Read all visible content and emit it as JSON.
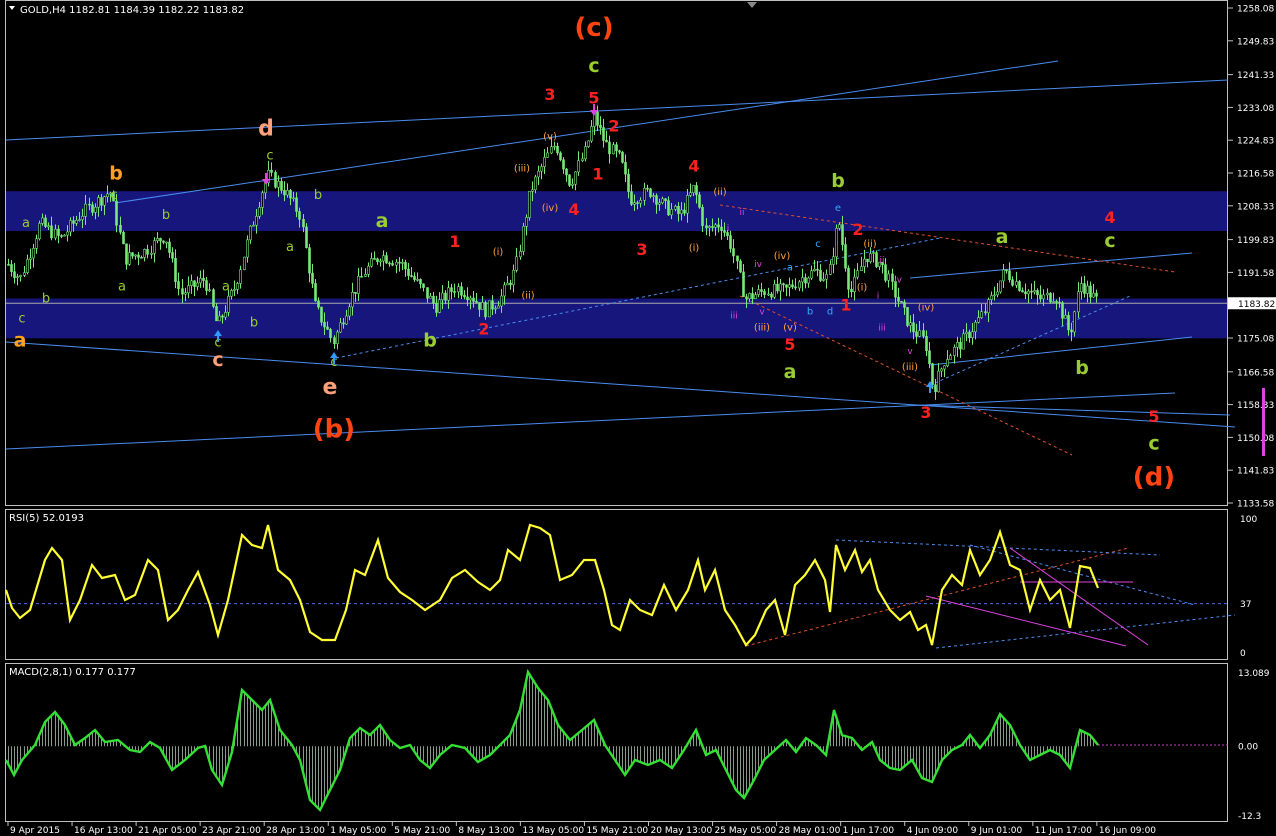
{
  "header": {
    "title": "GOLD,H4  1182.81 1184.39 1182.22 1183.82"
  },
  "colors": {
    "background": "#000000",
    "frame": "#c0c0c0",
    "zone": "#16167c",
    "candle": "#78e878",
    "rsi": "#ffff33",
    "macd": "#33e033",
    "price_tag": "#ffffff",
    "trend": "#4a8cf0"
  },
  "price_axis": {
    "ticks": [
      "1258.08",
      "1249.83",
      "1241.33",
      "1233.08",
      "1224.83",
      "1216.58",
      "1208.33",
      "1199.83",
      "1191.58",
      "1183.82",
      "1175.08",
      "1166.58",
      "1158.33",
      "1150.08",
      "1141.83",
      "1133.58"
    ],
    "current": "1183.82"
  },
  "time_axis": {
    "labels": [
      "9 Apr 2015",
      "16 Apr 13:00",
      "21 Apr 05:00",
      "23 Apr 21:00",
      "28 Apr 13:00",
      "1 May 05:00",
      "5 May 21:00",
      "8 May 13:00",
      "13 May 05:00",
      "15 May 21:00",
      "20 May 13:00",
      "25 May 05:00",
      "28 May 01:00",
      "1 Jun 17:00",
      "4 Jun 09:00",
      "9 Jun 01:00",
      "11 Jun 17:00",
      "16 Jun 09:00"
    ]
  },
  "rsi": {
    "label": "RSI(5) 52.0193",
    "ticks": [
      "100",
      "37",
      "0"
    ]
  },
  "macd": {
    "label": "MACD(2,8,1) 0.177 0.177",
    "ticks": [
      "13.089",
      "0.00",
      "-12.3"
    ]
  },
  "chart_data": [
    {
      "type": "candlestick",
      "title": "GOLD,H4",
      "ylim": [
        1133.58,
        1258.08
      ],
      "last": {
        "open": 1182.81,
        "high": 1184.39,
        "low": 1182.22,
        "close": 1183.82
      },
      "path": [
        [
          0,
          1196
        ],
        [
          20,
          1190
        ],
        [
          40,
          1204
        ],
        [
          60,
          1200
        ],
        [
          80,
          1206
        ],
        [
          110,
          1212
        ],
        [
          125,
          1195
        ],
        [
          145,
          1197
        ],
        [
          165,
          1201
        ],
        [
          180,
          1186
        ],
        [
          205,
          1190
        ],
        [
          217,
          1178
        ],
        [
          235,
          1188
        ],
        [
          250,
          1202
        ],
        [
          262,
          1212
        ],
        [
          268,
          1216
        ],
        [
          285,
          1212
        ],
        [
          300,
          1206
        ],
        [
          315,
          1183
        ],
        [
          333,
          1174
        ],
        [
          350,
          1185
        ],
        [
          365,
          1192
        ],
        [
          380,
          1196
        ],
        [
          400,
          1194
        ],
        [
          420,
          1188
        ],
        [
          435,
          1183
        ],
        [
          455,
          1188
        ],
        [
          470,
          1186
        ],
        [
          485,
          1182
        ],
        [
          500,
          1185
        ],
        [
          515,
          1192
        ],
        [
          530,
          1212
        ],
        [
          545,
          1220
        ],
        [
          555,
          1224
        ],
        [
          570,
          1214
        ],
        [
          585,
          1222
        ],
        [
          594,
          1231
        ],
        [
          605,
          1224
        ],
        [
          620,
          1220
        ],
        [
          630,
          1210
        ],
        [
          650,
          1212
        ],
        [
          665,
          1208
        ],
        [
          680,
          1206
        ],
        [
          694,
          1213
        ],
        [
          705,
          1202
        ],
        [
          720,
          1204
        ],
        [
          730,
          1199
        ],
        [
          745,
          1185
        ],
        [
          765,
          1187
        ],
        [
          785,
          1187
        ],
        [
          800,
          1190
        ],
        [
          815,
          1192
        ],
        [
          828,
          1190
        ],
        [
          838,
          1205
        ],
        [
          850,
          1186
        ],
        [
          865,
          1196
        ],
        [
          880,
          1194
        ],
        [
          895,
          1186
        ],
        [
          910,
          1178
        ],
        [
          925,
          1174
        ],
        [
          933,
          1162
        ],
        [
          945,
          1170
        ],
        [
          965,
          1175
        ],
        [
          985,
          1182
        ],
        [
          1005,
          1192
        ],
        [
          1020,
          1188
        ],
        [
          1040,
          1185
        ],
        [
          1055,
          1186
        ],
        [
          1070,
          1176
        ],
        [
          1080,
          1189
        ],
        [
          1098,
          1184
        ]
      ],
      "zones": [
        [
          1202,
          1212
        ],
        [
          1175,
          1185
        ]
      ],
      "series": [
        {
          "name": "RSI(5)",
          "ylim": [
            0,
            100
          ],
          "levels": [
            37
          ]
        },
        {
          "name": "MACD(2,8,1)",
          "ylim": [
            -12.3,
            13.089
          ]
        }
      ]
    }
  ],
  "annotations": [
    {
      "t": "(c)",
      "x": 594,
      "p": 1251,
      "c": "#ff4411",
      "s": 26
    },
    {
      "t": "c",
      "x": 594,
      "p": 1242,
      "c": "#9acd32",
      "s": 19
    },
    {
      "t": "3",
      "x": 550,
      "p": 1235,
      "c": "#ff2020",
      "s": 16
    },
    {
      "t": "5",
      "x": 594,
      "p": 1234,
      "c": "#ff2020",
      "s": 16
    },
    {
      "t": "2",
      "x": 614,
      "p": 1227,
      "c": "#ff2020",
      "s": 16
    },
    {
      "t": "1",
      "x": 598,
      "p": 1215,
      "c": "#ff2020",
      "s": 16
    },
    {
      "t": "4",
      "x": 574,
      "p": 1206,
      "c": "#ff2020",
      "s": 16
    },
    {
      "t": "(v)",
      "x": 550,
      "p": 1225,
      "c": "#ffa040",
      "s": 10
    },
    {
      "t": "(iii)",
      "x": 522,
      "p": 1217,
      "c": "#ffa040",
      "s": 10
    },
    {
      "t": "(iv)",
      "x": 550,
      "p": 1207,
      "c": "#ffa040",
      "s": 10
    },
    {
      "t": "(i)",
      "x": 498,
      "p": 1196,
      "c": "#ffa040",
      "s": 10
    },
    {
      "t": "(ii)",
      "x": 528,
      "p": 1185,
      "c": "#ffa040",
      "s": 10
    },
    {
      "t": "3",
      "x": 642,
      "p": 1196,
      "c": "#ff2020",
      "s": 16
    },
    {
      "t": "4",
      "x": 694,
      "p": 1217,
      "c": "#ff2020",
      "s": 16
    },
    {
      "t": "(ii)",
      "x": 720,
      "p": 1211,
      "c": "#ffa040",
      "s": 10
    },
    {
      "t": "(i)",
      "x": 694,
      "p": 1197,
      "c": "#ffa040",
      "s": 10
    },
    {
      "t": "ii",
      "x": 742,
      "p": 1206,
      "c": "#dd44dd",
      "s": 9
    },
    {
      "t": "i",
      "x": 728,
      "p": 1202,
      "c": "#dd44dd",
      "s": 9
    },
    {
      "t": "iv",
      "x": 758,
      "p": 1193,
      "c": "#dd44dd",
      "s": 9
    },
    {
      "t": "(iv)",
      "x": 782,
      "p": 1195,
      "c": "#ffa040",
      "s": 10
    },
    {
      "t": "a",
      "x": 790,
      "p": 1192,
      "c": "#33aaff",
      "s": 10
    },
    {
      "t": "c",
      "x": 818,
      "p": 1198,
      "c": "#33aaff",
      "s": 10
    },
    {
      "t": "e",
      "x": 838,
      "p": 1207,
      "c": "#33aaff",
      "s": 10
    },
    {
      "t": "b",
      "x": 810,
      "p": 1181,
      "c": "#33aaff",
      "s": 10
    },
    {
      "t": "d",
      "x": 830,
      "p": 1181,
      "c": "#33aaff",
      "s": 10
    },
    {
      "t": "v",
      "x": 762,
      "p": 1181,
      "c": "#dd44dd",
      "s": 9
    },
    {
      "t": "iii",
      "x": 734,
      "p": 1180,
      "c": "#dd44dd",
      "s": 9
    },
    {
      "t": "(iii)",
      "x": 762,
      "p": 1177,
      "c": "#ffa040",
      "s": 10
    },
    {
      "t": "(v)",
      "x": 790,
      "p": 1177,
      "c": "#ffa040",
      "s": 10
    },
    {
      "t": "5",
      "x": 790,
      "p": 1172,
      "c": "#ff2020",
      "s": 16
    },
    {
      "t": "a",
      "x": 790,
      "p": 1165,
      "c": "#9acd32",
      "s": 19
    },
    {
      "t": "b",
      "x": 838,
      "p": 1213,
      "c": "#9acd32",
      "s": 19
    },
    {
      "t": "2",
      "x": 858,
      "p": 1201,
      "c": "#ff2020",
      "s": 16
    },
    {
      "t": "1",
      "x": 846,
      "p": 1182,
      "c": "#ff2020",
      "s": 16
    },
    {
      "t": "(ii)",
      "x": 870,
      "p": 1198,
      "c": "#ffa040",
      "s": 10
    },
    {
      "t": "ii",
      "x": 882,
      "p": 1194,
      "c": "#dd44dd",
      "s": 9
    },
    {
      "t": "(i)",
      "x": 862,
      "p": 1187,
      "c": "#ffa040",
      "s": 10
    },
    {
      "t": "i",
      "x": 878,
      "p": 1185,
      "c": "#dd44dd",
      "s": 9
    },
    {
      "t": "iv",
      "x": 898,
      "p": 1189,
      "c": "#dd44dd",
      "s": 9
    },
    {
      "t": "iii",
      "x": 882,
      "p": 1177,
      "c": "#dd44dd",
      "s": 9
    },
    {
      "t": "(iv)",
      "x": 926,
      "p": 1182,
      "c": "#ffa040",
      "s": 10
    },
    {
      "t": "v",
      "x": 910,
      "p": 1171,
      "c": "#dd44dd",
      "s": 9
    },
    {
      "t": "(iii)",
      "x": 910,
      "p": 1167,
      "c": "#ffa040",
      "s": 10
    },
    {
      "t": "3",
      "x": 926,
      "p": 1155,
      "c": "#ff2020",
      "s": 16
    },
    {
      "t": "a",
      "x": 1002,
      "p": 1199,
      "c": "#9acd32",
      "s": 19
    },
    {
      "t": "b",
      "x": 1082,
      "p": 1166,
      "c": "#9acd32",
      "s": 19
    },
    {
      "t": "4",
      "x": 1110,
      "p": 1204,
      "c": "#ff2020",
      "s": 16
    },
    {
      "t": "c",
      "x": 1110,
      "p": 1198,
      "c": "#9acd32",
      "s": 19
    },
    {
      "t": "5",
      "x": 1154,
      "p": 1154,
      "c": "#ff2020",
      "s": 16
    },
    {
      "t": "c",
      "x": 1154,
      "p": 1147,
      "c": "#9acd32",
      "s": 19
    },
    {
      "t": "(d)",
      "x": 1154,
      "p": 1138,
      "c": "#ff4411",
      "s": 26
    },
    {
      "t": "b",
      "x": 116,
      "p": 1215,
      "c": "#ffa020",
      "s": 19
    },
    {
      "t": "c",
      "x": 114,
      "p": 1210,
      "c": "#9acd32",
      "s": 13
    },
    {
      "t": "b",
      "x": 166,
      "p": 1205,
      "c": "#9acd32",
      "s": 13
    },
    {
      "t": "a",
      "x": 26,
      "p": 1203,
      "c": "#9acd32",
      "s": 13
    },
    {
      "t": "b",
      "x": 46,
      "p": 1184,
      "c": "#9acd32",
      "s": 13
    },
    {
      "t": "a",
      "x": 122,
      "p": 1187,
      "c": "#9acd32",
      "s": 13
    },
    {
      "t": "c",
      "x": 22,
      "p": 1179,
      "c": "#9acd32",
      "s": 13
    },
    {
      "t": "a",
      "x": 20,
      "p": 1173,
      "c": "#ffa020",
      "s": 19
    },
    {
      "t": "d",
      "x": 266,
      "p": 1226,
      "c": "#ffa07a",
      "s": 22
    },
    {
      "t": "c",
      "x": 270,
      "p": 1220,
      "c": "#9acd32",
      "s": 13
    },
    {
      "t": "b",
      "x": 318,
      "p": 1210,
      "c": "#9acd32",
      "s": 13
    },
    {
      "t": "a",
      "x": 290,
      "p": 1197,
      "c": "#9acd32",
      "s": 13
    },
    {
      "t": "a",
      "x": 226,
      "p": 1187,
      "c": "#9acd32",
      "s": 13
    },
    {
      "t": "b",
      "x": 254,
      "p": 1178,
      "c": "#9acd32",
      "s": 13
    },
    {
      "t": "c",
      "x": 218,
      "p": 1173,
      "c": "#9acd32",
      "s": 13
    },
    {
      "t": "c",
      "x": 218,
      "p": 1168,
      "c": "#ffa07a",
      "s": 19
    },
    {
      "t": "c",
      "x": 334,
      "p": 1168,
      "c": "#9acd32",
      "s": 13
    },
    {
      "t": "e",
      "x": 330,
      "p": 1161,
      "c": "#ffa07a",
      "s": 22
    },
    {
      "t": "(b)",
      "x": 334,
      "p": 1150,
      "c": "#ff4411",
      "s": 26
    },
    {
      "t": "a",
      "x": 382,
      "p": 1203,
      "c": "#9acd32",
      "s": 19
    },
    {
      "t": "b",
      "x": 430,
      "p": 1173,
      "c": "#9acd32",
      "s": 19
    },
    {
      "t": "1",
      "x": 455,
      "p": 1198,
      "c": "#ff2020",
      "s": 16
    },
    {
      "t": "2",
      "x": 484,
      "p": 1176,
      "c": "#ff2020",
      "s": 16
    }
  ]
}
